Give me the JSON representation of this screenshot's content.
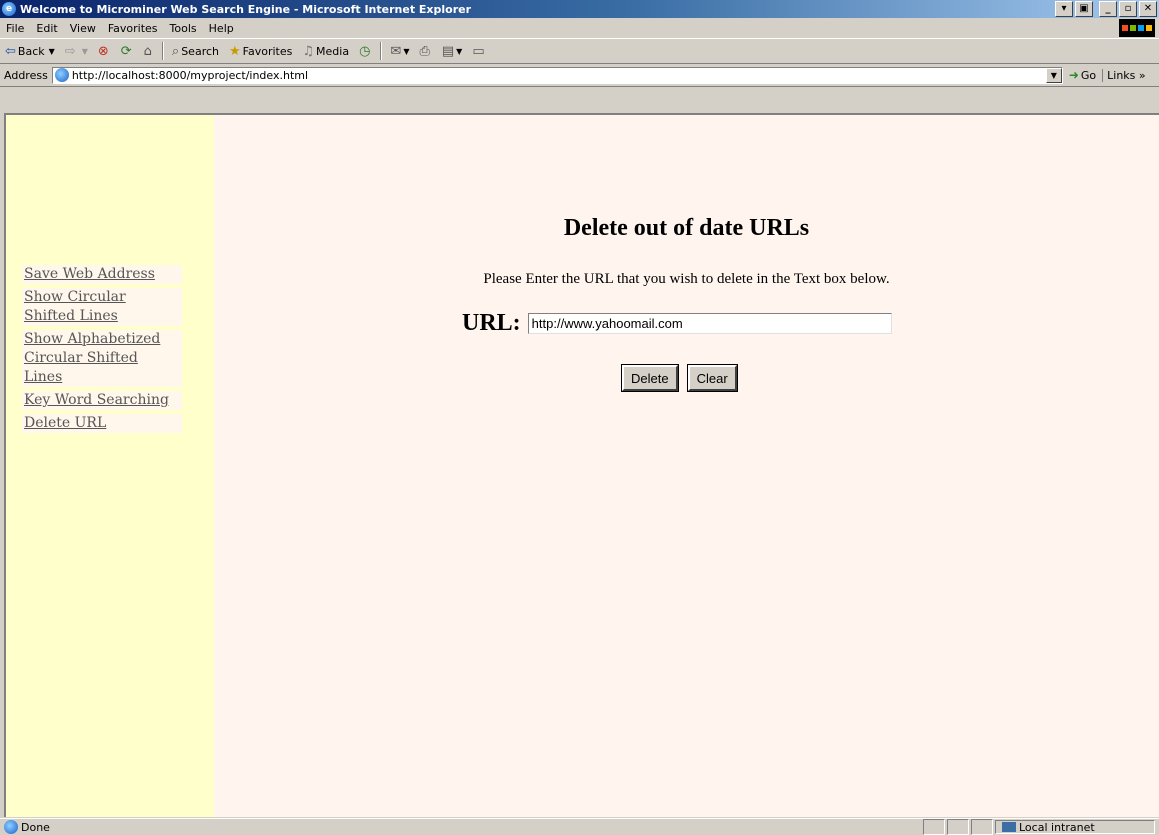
{
  "window": {
    "title": "Welcome to Microminer Web Search Engine - Microsoft Internet Explorer",
    "buttons": [
      "minimize",
      "maximize",
      "close"
    ]
  },
  "menubar": {
    "items": [
      "File",
      "Edit",
      "View",
      "Favorites",
      "Tools",
      "Help"
    ]
  },
  "toolbar": {
    "back": "Back",
    "search": "Search",
    "favorites": "Favorites",
    "media": "Media"
  },
  "addressbar": {
    "label": "Address",
    "url": "http://localhost:8000/myproject/index.html",
    "go": "Go",
    "links": "Links"
  },
  "sidebar": {
    "items": [
      {
        "label": "Save Web Address"
      },
      {
        "label": "Show Circular Shifted Lines"
      },
      {
        "label": "Show Alphabetized Circular Shifted Lines"
      },
      {
        "label": "Key Word Searching"
      },
      {
        "label": "Delete URL"
      }
    ]
  },
  "main": {
    "heading": "Delete out of date URLs",
    "instruction": "Please Enter the URL that you wish to delete in the Text box below.",
    "url_label": "URL:",
    "url_value": "http://www.yahoomail.com",
    "delete_label": "Delete",
    "clear_label": "Clear"
  },
  "statusbar": {
    "text": "Done",
    "zone": "Local intranet"
  },
  "colors": {
    "sidebar_bg": "#ffffcc",
    "main_bg": "#fff5ee",
    "titlebar": "#0a246a"
  }
}
